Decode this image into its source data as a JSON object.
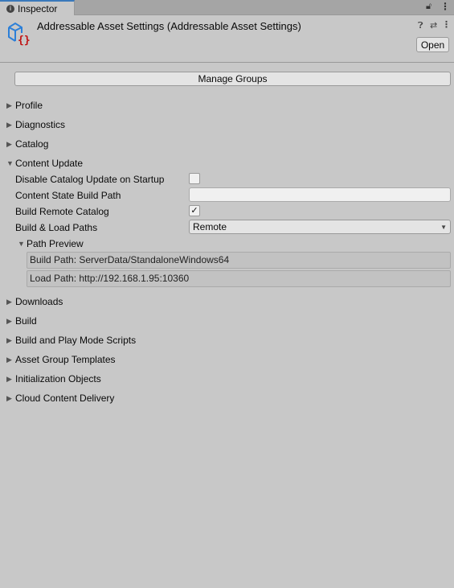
{
  "tab": {
    "label": "Inspector",
    "icon": "info-icon"
  },
  "header": {
    "title": "Addressable Asset Settings (Addressable Asset Settings)",
    "open_label": "Open",
    "icons": [
      "help-icon",
      "settings-sliders-icon",
      "more-menu-icon"
    ]
  },
  "manage_groups_label": "Manage Groups",
  "sections": {
    "profile": "Profile",
    "diagnostics": "Diagnostics",
    "catalog": "Catalog",
    "content_update": "Content Update",
    "downloads": "Downloads",
    "build": "Build",
    "build_play": "Build and Play Mode Scripts",
    "templates": "Asset Group Templates",
    "init": "Initialization Objects",
    "ccd": "Cloud Content Delivery"
  },
  "content_update": {
    "disable_catalog_label": "Disable Catalog Update on Startup",
    "disable_catalog_value": false,
    "state_path_label": "Content State Build Path",
    "state_path_value": "",
    "remote_catalog_label": "Build Remote Catalog",
    "remote_catalog_value": true,
    "check_mark": "✓",
    "paths_label": "Build & Load Paths",
    "paths_value": "Remote",
    "preview_label": "Path Preview",
    "build_path": "Build Path: ServerData/StandaloneWindows64",
    "load_path": "Load Path: http://192.168.1.95:10360"
  },
  "colors": {
    "tab_accent": "#3a79bb",
    "asset_icon_blue": "#2b7fd8",
    "asset_icon_red": "#c01010"
  }
}
